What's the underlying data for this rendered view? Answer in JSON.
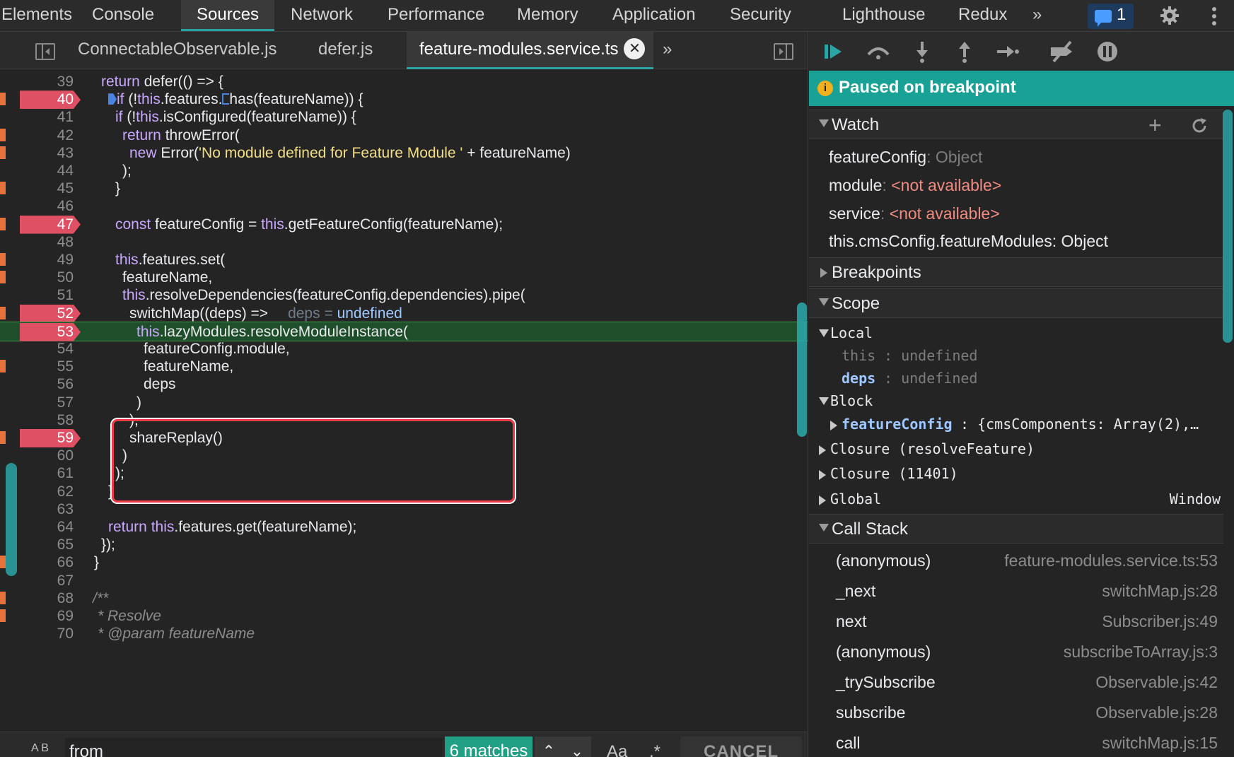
{
  "devtools_tabs": [
    {
      "label": "Elements"
    },
    {
      "label": "Console"
    },
    {
      "label": "Sources"
    },
    {
      "label": "Network"
    },
    {
      "label": "Performance"
    },
    {
      "label": "Memory"
    },
    {
      "label": "Application"
    },
    {
      "label": "Security"
    },
    {
      "label": "Lighthouse"
    },
    {
      "label": "Redux"
    }
  ],
  "overflow_label": "»",
  "message_count": "1",
  "file_tabs": [
    {
      "label": "ConnectableObservable.js"
    },
    {
      "label": "defer.js"
    },
    {
      "label": "feature-modules.service.ts"
    }
  ],
  "file_tab_close": "✕",
  "code_lines": [
    {
      "n": "39"
    },
    {
      "n": "40"
    },
    {
      "n": "41"
    },
    {
      "n": "42"
    },
    {
      "n": "43"
    },
    {
      "n": "44"
    },
    {
      "n": "45"
    },
    {
      "n": "46"
    },
    {
      "n": "47"
    },
    {
      "n": "48"
    },
    {
      "n": "49"
    },
    {
      "n": "50"
    },
    {
      "n": "51"
    },
    {
      "n": "52"
    },
    {
      "n": "53"
    },
    {
      "n": "54"
    },
    {
      "n": "55"
    },
    {
      "n": "56"
    },
    {
      "n": "57"
    },
    {
      "n": "58"
    },
    {
      "n": "59"
    },
    {
      "n": "60"
    },
    {
      "n": "61"
    },
    {
      "n": "62"
    },
    {
      "n": "63"
    },
    {
      "n": "64"
    },
    {
      "n": "65"
    },
    {
      "n": "66"
    },
    {
      "n": "67"
    },
    {
      "n": "68"
    },
    {
      "n": "69"
    },
    {
      "n": "70"
    }
  ],
  "code_text": {
    "l39a": "return",
    "l39b": " defer(() => {",
    "l40a": "if",
    "l40b": " (!",
    "l40c": "this",
    "l40d": ".features.",
    "l40e": "has(featureName)) {",
    "l41a": "if",
    "l41b": " (!",
    "l41c": "this",
    "l41d": ".isConfigured(featureName)) {",
    "l42a": "return",
    "l42b": " throwError(",
    "l43a": "new",
    "l43b": " Error(",
    "l43c": "'No module defined for Feature Module '",
    "l43d": " + featureName)",
    "l44": ");",
    "l45": "}",
    "l47a": "const",
    "l47b": " featureConfig = ",
    "l47c": "this",
    "l47d": ".getFeatureConfig(featureName);",
    "l49a": "this",
    "l49b": ".features.set(",
    "l50": "featureName,",
    "l51a": "this",
    "l51b": ".resolveDependencies(featureConfig.dependencies).pipe(",
    "l52a": "switchMap((deps) =>",
    "l52b": "deps = ",
    "l52c": "undefined",
    "l53a": "this",
    "l53b": ".lazyModules.resolveModuleInstance(",
    "l54": "featureConfig.module,",
    "l55": "featureName,",
    "l56": "deps",
    "l57": ")",
    "l58": "),",
    "l59": "shareReplay()",
    "l60": ")",
    "l61": ");",
    "l62": "}",
    "l64a": "return",
    "l64b": " ",
    "l64c": "this",
    "l64d": ".features.get(featureName);",
    "l65": "});",
    "l66": "}",
    "l68": "/**",
    "l69": "* Resolve",
    "l70": "* @param featureName"
  },
  "search": {
    "value": "from",
    "matches": "6 matches",
    "up": "⌃",
    "down": "⌄",
    "case_label": "Aa",
    "regex_label": ".*",
    "cancel_label": "CANCEL",
    "icon_text": "A B"
  },
  "debugger": {
    "paused_label": "Paused on breakpoint",
    "watch_title": "Watch",
    "watch_items": [
      {
        "name": "featureConfig",
        "sep": ": ",
        "value": "Object",
        "value_kind": "grey"
      },
      {
        "name": "module",
        "sep": ": ",
        "value": "<not available>",
        "value_kind": "red"
      },
      {
        "name": "service",
        "sep": ": ",
        "value": "<not available>",
        "value_kind": "red"
      },
      {
        "name": "this.cmsConfig.featureModules",
        "sep": ": ",
        "value": "Object",
        "value_kind": "white"
      }
    ],
    "breakpoints_title": "Breakpoints",
    "scope_title": "Scope",
    "scope": {
      "local_label": "Local",
      "this_key": "this",
      "this_val": ": undefined",
      "deps_key": "deps",
      "deps_val": ": undefined",
      "block_label": "Block",
      "fc_key": "featureConfig",
      "fc_val": ": {cmsComponents: Array(2),…",
      "closure1": "Closure (resolveFeature)",
      "closure2": "Closure (11401)",
      "global_label": "Global",
      "global_val": "Window"
    },
    "callstack_title": "Call Stack",
    "call_stack": [
      {
        "fn": "(anonymous)",
        "loc": "feature-modules.service.ts:53"
      },
      {
        "fn": "_next",
        "loc": "switchMap.js:28"
      },
      {
        "fn": "next",
        "loc": "Subscriber.js:49"
      },
      {
        "fn": "(anonymous)",
        "loc": "subscribeToArray.js:3"
      },
      {
        "fn": "_trySubscribe",
        "loc": "Observable.js:42"
      },
      {
        "fn": "subscribe",
        "loc": "Observable.js:28"
      },
      {
        "fn": "call",
        "loc": "switchMap.js:15"
      }
    ]
  },
  "colors": {
    "accent": "#2aa4a4",
    "paused_banner": "#19a196",
    "breakpoint": "#e05064",
    "current_line": "#1f4e2a",
    "highlight_box": "#ec3b48",
    "match_badge": "#22a085"
  },
  "icons": {
    "resume": "resume-icon",
    "step_over": "step-over-icon",
    "step_into": "step-into-icon",
    "step_out": "step-out-icon",
    "step": "step-icon",
    "deactivate": "deactivate-breakpoints-icon",
    "pause_exceptions": "pause-on-exceptions-icon",
    "settings": "gear-icon",
    "more": "more-vert-icon"
  }
}
